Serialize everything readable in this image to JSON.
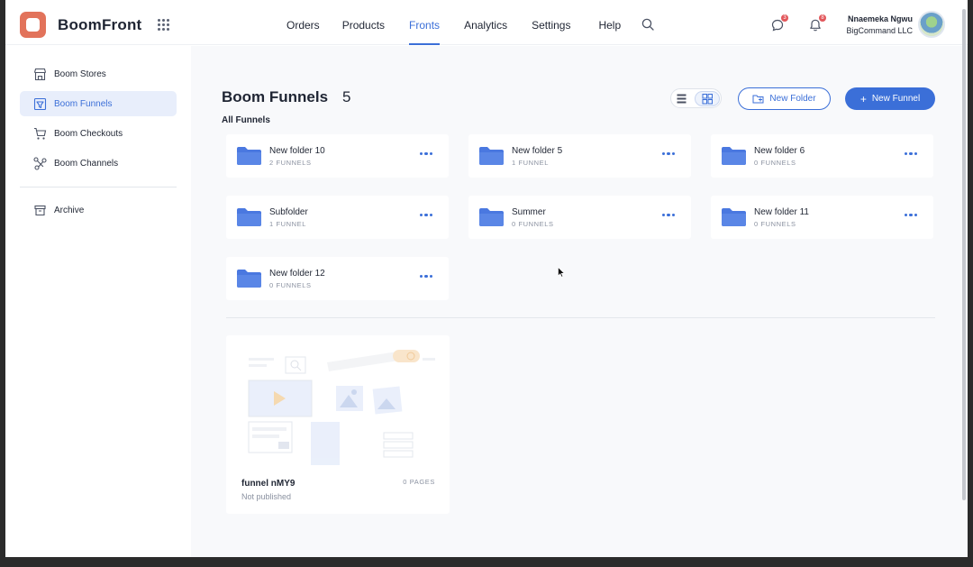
{
  "header": {
    "brand": "BoomFront",
    "nav": [
      {
        "label": "Orders",
        "active": false
      },
      {
        "label": "Products",
        "active": false
      },
      {
        "label": "Fronts",
        "active": true
      },
      {
        "label": "Analytics",
        "active": false
      },
      {
        "label": "Settings",
        "active": false
      },
      {
        "label": "Help",
        "active": false
      }
    ],
    "chat_badge": "3",
    "bell_badge": "8",
    "user_name": "Nnaemeka Ngwu",
    "user_org": "BigCommand LLC"
  },
  "sidebar": {
    "items": [
      {
        "label": "Boom Stores",
        "icon": "store-icon",
        "active": false
      },
      {
        "label": "Boom Funnels",
        "icon": "funnel-icon",
        "active": true
      },
      {
        "label": "Boom Checkouts",
        "icon": "cart-icon",
        "active": false
      },
      {
        "label": "Boom Channels",
        "icon": "channels-icon",
        "active": false
      }
    ],
    "archive_label": "Archive"
  },
  "main": {
    "title": "Boom Funnels",
    "count": "5",
    "section_label": "All Funnels",
    "new_folder_label": "New Folder",
    "new_funnel_label": "New Funnel",
    "folders": [
      {
        "name": "New folder 10",
        "count": "2 FUNNELS"
      },
      {
        "name": "New folder 5",
        "count": "1 FUNNEL"
      },
      {
        "name": "New folder 6",
        "count": "0 FUNNELS"
      },
      {
        "name": "Subfolder",
        "count": "1 FUNNEL"
      },
      {
        "name": "Summer",
        "count": "0 FUNNELS"
      },
      {
        "name": "New folder 11",
        "count": "0 FUNNELS"
      },
      {
        "name": "New folder 12",
        "count": "0 FUNNELS"
      }
    ],
    "funnel": {
      "name": "funnel nMY9",
      "status": "Not published",
      "pages": "0 PAGES"
    }
  },
  "colors": {
    "accent": "#3b6fd8",
    "brand": "#e2735b",
    "folder": "#4a78e0"
  }
}
